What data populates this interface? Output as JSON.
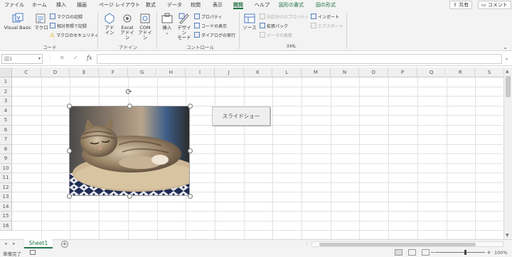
{
  "tabs": [
    {
      "label": "ファイル"
    },
    {
      "label": "ホーム"
    },
    {
      "label": "挿入"
    },
    {
      "label": "描画"
    },
    {
      "label": "ページ レイアウト"
    },
    {
      "label": "数式"
    },
    {
      "label": "データ"
    },
    {
      "label": "校閲"
    },
    {
      "label": "表示"
    },
    {
      "label": "開発",
      "active": true
    },
    {
      "label": "ヘルプ"
    },
    {
      "label": "図形の書式"
    },
    {
      "label": "図の形式"
    }
  ],
  "share_label": "共有",
  "comment_label": "コメント",
  "ribbon": {
    "code": {
      "label": "コード",
      "visual_basic": "Visual Basic",
      "macro": "マクロ",
      "record_macro": "マクロの記録",
      "relative_ref": "相対参照で記録",
      "macro_security": "マクロのセキュリティ"
    },
    "addins": {
      "label": "アドイン",
      "addin_1": "アド",
      "addin_2": "イン",
      "excel_addin_1": "Excel",
      "excel_addin_2": "アドイン",
      "com_addin_1": "COM",
      "com_addin_2": "アドイン"
    },
    "controls": {
      "label": "コントロール",
      "insert": "挿入",
      "insert_caret": "⌄",
      "design_mode_1": "デザイン",
      "design_mode_2": "モード",
      "properties": "プロパティ",
      "view_code": "コードの表示",
      "run_dialog": "ダイアログの実行"
    },
    "xml": {
      "label": "XML",
      "source": "ソース",
      "map_properties": "対応付けのプロパティ",
      "expansion_packs": "拡張パック",
      "refresh_data": "データの更新",
      "import": "インポート",
      "export": "エクスポート"
    }
  },
  "formula_bar": {
    "name_box": "図1",
    "cancel_icon": "✕",
    "enter_icon": "✓",
    "fx_label": "fx",
    "value": ""
  },
  "columns": [
    "C",
    "D",
    "E",
    "F",
    "G",
    "H",
    "I",
    "J",
    "K",
    "L",
    "M",
    "N",
    "O",
    "P",
    "Q",
    "R",
    "S"
  ],
  "rows": [
    "1",
    "2",
    "3",
    "4",
    "5",
    "6",
    "7",
    "8",
    "9",
    "10",
    "11",
    "12",
    "13",
    "14",
    "15",
    "16"
  ],
  "form_button_label": "スライドショー",
  "sheet_tab": "Sheet1",
  "status": {
    "ready": "準備完了",
    "zoom": "100%"
  },
  "colors": {
    "accent": "#217346",
    "ribbon_bg": "#f3f3f3"
  },
  "icons": {
    "share": "share-icon",
    "comment": "comment-icon",
    "rotate": "rotate-handle-icon"
  }
}
